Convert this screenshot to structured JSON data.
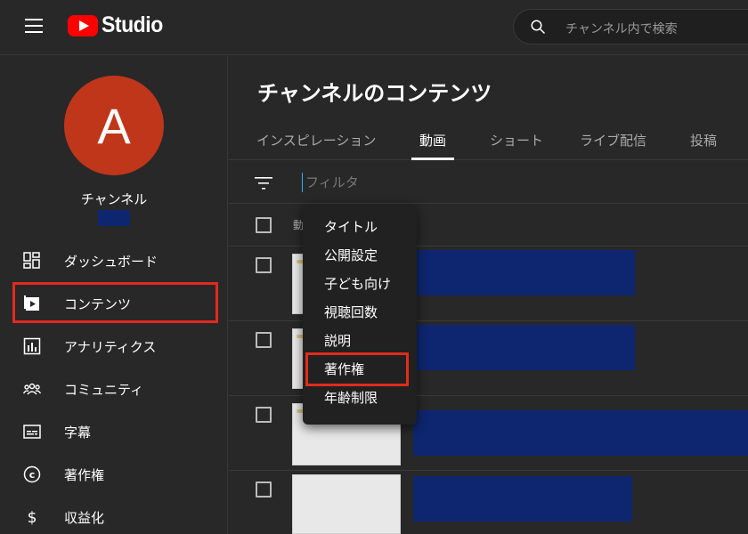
{
  "header": {
    "logo_text": "Studio",
    "search_placeholder": "チャンネル内で検索"
  },
  "sidebar": {
    "avatar_letter": "A",
    "channel_name": "チャンネル",
    "items": [
      {
        "label": "ダッシュボード",
        "icon": "dashboard-icon"
      },
      {
        "label": "コンテンツ",
        "icon": "content-icon",
        "selected": true
      },
      {
        "label": "アナリティクス",
        "icon": "analytics-icon"
      },
      {
        "label": "コミュニティ",
        "icon": "community-icon"
      },
      {
        "label": "字幕",
        "icon": "subtitles-icon"
      },
      {
        "label": "著作権",
        "icon": "copyright-icon"
      },
      {
        "label": "収益化",
        "icon": "monetization-icon"
      }
    ]
  },
  "main": {
    "title": "チャンネルのコンテンツ",
    "tabs": [
      {
        "label": "インスピレーション"
      },
      {
        "label": "動画",
        "active": true
      },
      {
        "label": "ショート"
      },
      {
        "label": "ライブ配信"
      },
      {
        "label": "投稿"
      }
    ],
    "filter_placeholder": "フィルタ",
    "column_header": "動"
  },
  "filter_menu": {
    "items": [
      "タイトル",
      "公開設定",
      "子ども向け",
      "視聴回数",
      "説明",
      "著作権",
      "年齢制限"
    ],
    "highlighted": "著作権"
  },
  "colors": {
    "background": "#282828",
    "accent_red": "#e32a1c",
    "avatar": "#c0361b",
    "redaction": "#0e2670"
  }
}
